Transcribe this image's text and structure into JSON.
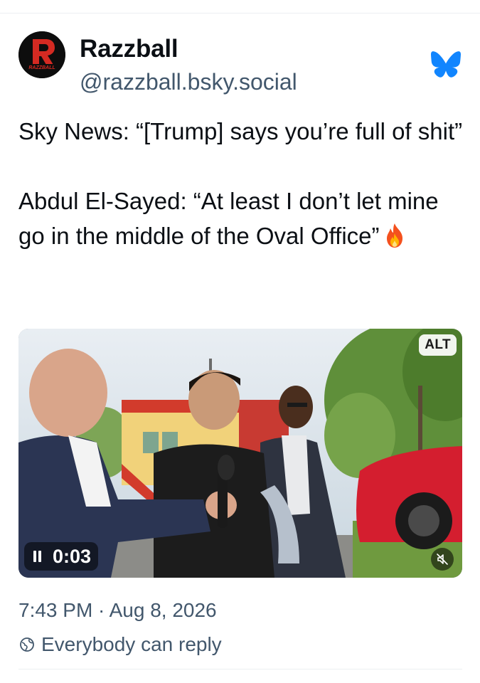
{
  "author": {
    "display_name": "Razzball",
    "handle": "@razzball.bsky.social",
    "avatar_text": "RAZZBALL"
  },
  "platform_icon": "bluesky-butterfly-icon",
  "post": {
    "paragraph_1": "Sky News: “[Trump] says you’re full of shit”",
    "paragraph_2": "Abdul El-Sayed: “At least I don’t let mine go in the middle of the Oval Office”",
    "emoji": "fire-emoji"
  },
  "video": {
    "alt_label": "ALT",
    "timecode": "0:03",
    "state": "playing",
    "muted": true
  },
  "meta": {
    "timestamp": "7:43 PM · Aug 8, 2026",
    "reply_setting": "Everybody can reply"
  },
  "colors": {
    "text": "#0b0f14",
    "muted_text": "#42576c",
    "bluesky_blue": "#1185fe",
    "avatar_red": "#d42a22"
  }
}
